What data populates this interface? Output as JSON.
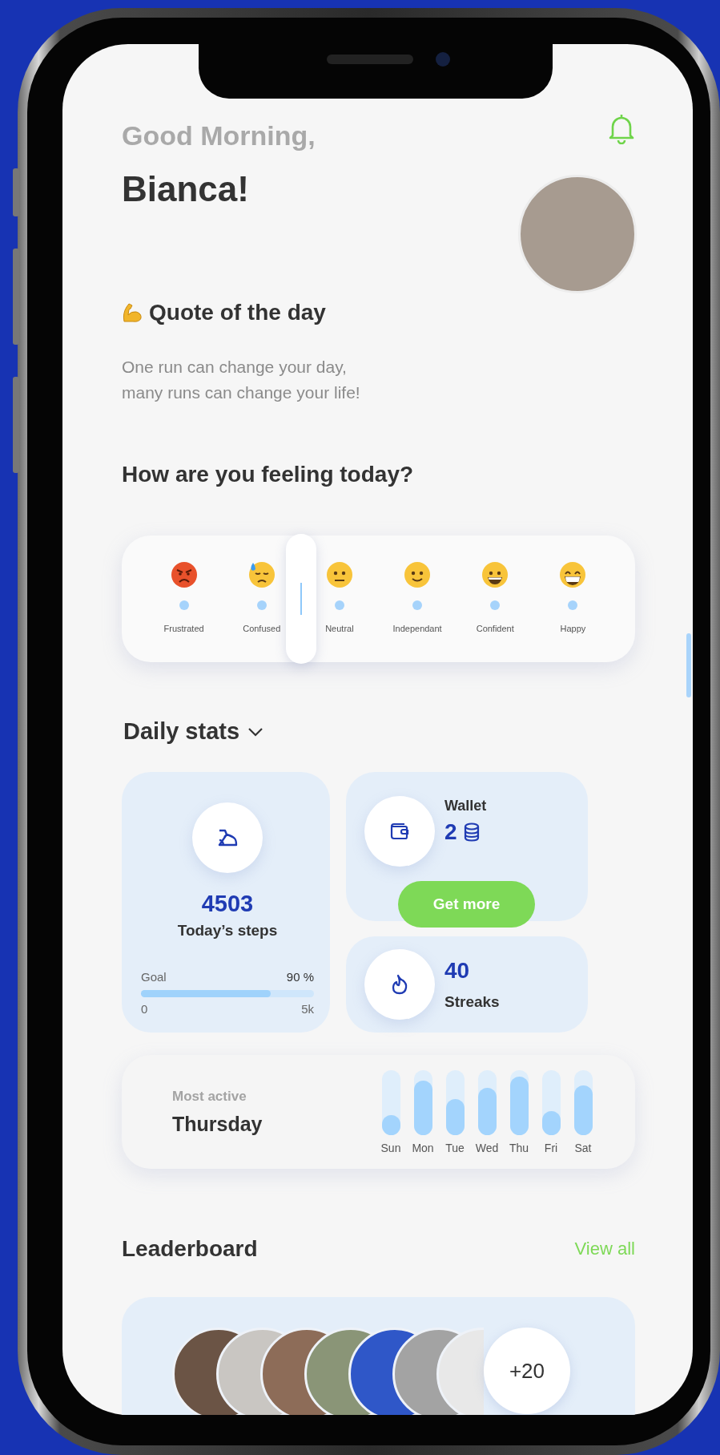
{
  "greeting": "Good Morning,",
  "name": "Bianca!",
  "quote": {
    "title": "Quote of the day",
    "lines": [
      "One run can change your day,",
      "many runs can change your life!"
    ]
  },
  "mood": {
    "title": "How are you feeling today?",
    "slider": {
      "level": 0.35
    },
    "options": [
      {
        "label": "Frustrated",
        "kind": "angry"
      },
      {
        "label": "Confused",
        "kind": "sweat"
      },
      {
        "label": "Neutral",
        "kind": "neutral"
      },
      {
        "label": "Independant",
        "kind": "smile"
      },
      {
        "label": "Confident",
        "kind": "grin"
      },
      {
        "label": "Happy",
        "kind": "beaming"
      }
    ]
  },
  "stats": {
    "title": "Daily stats",
    "steps": {
      "value": "4503",
      "label": "Today’s steps",
      "goal_label": "Goal",
      "goal_percent": "90 %",
      "level": 0.75,
      "min": "0",
      "max": "5k"
    },
    "wallet": {
      "title": "Wallet",
      "amount": "2",
      "button": "Get more"
    },
    "streaks": {
      "value": "40",
      "label": "Streaks"
    },
    "most_active": {
      "caption": "Most active",
      "day": "Thursday",
      "days": [
        {
          "label": "Sun",
          "level": 0.3
        },
        {
          "label": "Mon",
          "level": 0.83
        },
        {
          "label": "Tue",
          "level": 0.55
        },
        {
          "label": "Wed",
          "level": 0.72
        },
        {
          "label": "Thu",
          "level": 0.9
        },
        {
          "label": "Fri",
          "level": 0.37
        },
        {
          "label": "Sat",
          "level": 0.76
        }
      ]
    }
  },
  "leaderboard": {
    "title": "Leaderboard",
    "link": "View all",
    "more": "+20"
  }
}
